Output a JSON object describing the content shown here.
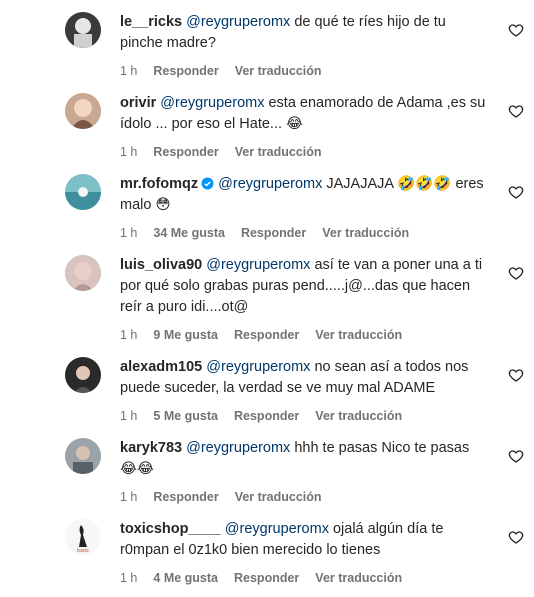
{
  "comments": [
    {
      "user": "le__ricks",
      "mention": "@reygruperomx",
      "text": " de qué te ríes hijo de tu pinche madre?",
      "time": "1 h",
      "likes": "",
      "reply": "Responder",
      "translate": "Ver traducción",
      "verified": false
    },
    {
      "user": "orivir",
      "mention": "@reygruperomx",
      "text": " esta enamorado de Adama ,es su ídolo ... por eso el Hate... 😂",
      "time": "1 h",
      "likes": "",
      "reply": "Responder",
      "translate": "Ver traducción",
      "verified": false
    },
    {
      "user": "mr.fofomqz",
      "mention": "@reygruperomx",
      "text": " JAJAJAJA 🤣🤣🤣 eres malo 😳",
      "time": "1 h",
      "likes": "34 Me gusta",
      "reply": "Responder",
      "translate": "Ver traducción",
      "verified": true
    },
    {
      "user": "luis_oliva90",
      "mention": "@reygruperomx",
      "text": " así te van a poner una a ti por qué solo grabas puras pend.....j@...das que hacen reír a puro idi....ot@",
      "time": "1 h",
      "likes": "9 Me gusta",
      "reply": "Responder",
      "translate": "Ver traducción",
      "verified": false
    },
    {
      "user": "alexadm105",
      "mention": "@reygruperomx",
      "text": " no sean así a todos nos puede suceder, la verdad se ve muy mal ADAME",
      "time": "1 h",
      "likes": "5 Me gusta",
      "reply": "Responder",
      "translate": "Ver traducción",
      "verified": false
    },
    {
      "user": "karyk783",
      "mention": "@reygruperomx",
      "text": " hhh te pasas Nico te pasas 😂😂",
      "time": "1 h",
      "likes": "",
      "reply": "Responder",
      "translate": "Ver traducción",
      "verified": false
    },
    {
      "user": "toxicshop____",
      "mention": "@reygruperomx",
      "text": " ojalá algún día te r0mpan el 0z1k0 bien merecido lo tienes",
      "time": "1 h",
      "likes": "4 Me gusta",
      "reply": "Responder",
      "translate": "Ver traducción",
      "verified": false
    }
  ],
  "icons": {
    "heart": "heart-outline-icon",
    "verified": "verified-badge-icon"
  },
  "colors": {
    "mention": "#00376b",
    "meta": "#737373",
    "verified": "#0095f6"
  }
}
